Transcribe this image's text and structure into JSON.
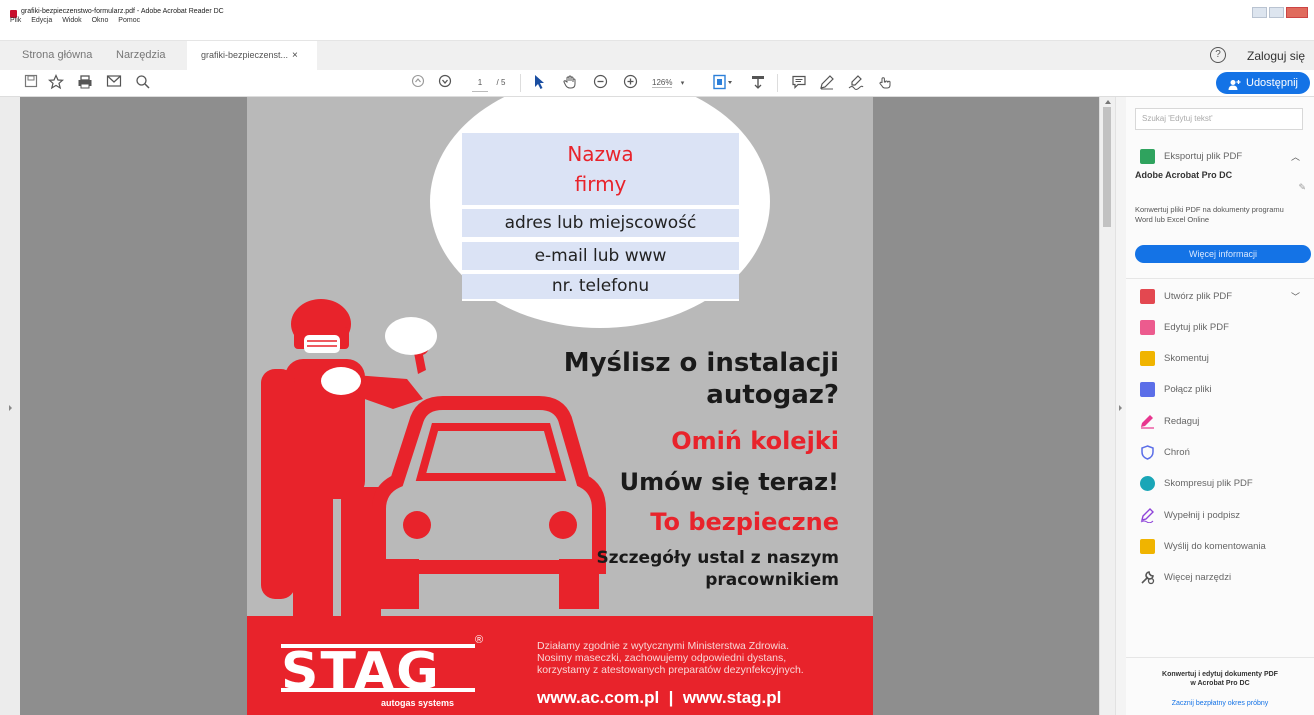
{
  "window": {
    "title": "grafiki-bezpieczenstwo-formularz.pdf - Adobe Acrobat Reader DC",
    "menu": [
      "Plik",
      "Edycja",
      "Widok",
      "Okno",
      "Pomoc"
    ]
  },
  "tabs": {
    "home": "Strona główna",
    "tools": "Narzędzia",
    "document": "grafiki-bezpieczenst...",
    "close": "×"
  },
  "header": {
    "help": "?",
    "login": "Zaloguj się"
  },
  "toolbar": {
    "page_current": "1",
    "page_total": "/ 5",
    "zoom": "126%",
    "share": "Udostępnij"
  },
  "document": {
    "company_name_line1": "Nazwa",
    "company_name_line2": "firmy",
    "address": "adres lub miejscowość",
    "email": "e-mail lub www",
    "phone": "nr. telefonu",
    "question_line1": "Myślisz o instalacji",
    "question_line2": "autogaz?",
    "skip_queue": "Omiń kolejki",
    "book_now": "Umów się teraz!",
    "safe": "To bezpieczne",
    "details_line1": "Szczegóły ustal z naszym",
    "details_line2": "pracownikiem",
    "logo_word": "STAG",
    "logo_sub": "autogas systems",
    "logo_reg": "®",
    "footer_line1": "Działamy zgodnie z wytycznymi Ministerstwa Zdrowia.",
    "footer_line2": "Nosimy maseczki, zachowujemy odpowiedni dystans,",
    "footer_line3": "korzystamy z atestowanych preparatów dezynfekcyjnych.",
    "urls": "www.ac.com.pl  |  www.stag.pl"
  },
  "right_panel": {
    "search_placeholder": "Szukaj 'Edytuj tekst'",
    "export": "Eksportuj plik PDF",
    "promo_title": "Adobe Acrobat Pro DC",
    "promo_text": "Konwertuj pliki PDF na dokumenty programu Word lub Excel Online",
    "promo_button": "Więcej informacji",
    "tools": [
      {
        "label": "Utwórz plik PDF",
        "color": "#e34850"
      },
      {
        "label": "Edytuj plik PDF",
        "color": "#ec5b8e"
      },
      {
        "label": "Skomentuj",
        "color": "#f0b400"
      },
      {
        "label": "Połącz pliki",
        "color": "#5b6ee8"
      },
      {
        "label": "Redaguj",
        "color": "#e8368f"
      },
      {
        "label": "Chroń",
        "color": "#5b6ee8"
      },
      {
        "label": "Skompresuj plik PDF",
        "color": "#1aa6b7"
      },
      {
        "label": "Wypełnij i podpisz",
        "color": "#8e44d9"
      },
      {
        "label": "Wyślij do komentowania",
        "color": "#f0b400"
      },
      {
        "label": "Więcej narzędzi",
        "color": "#555555"
      }
    ],
    "bottom_note_line1": "Konwertuj i edytuj dokumenty PDF",
    "bottom_note_line2": "w Acrobat Pro DC",
    "bottom_link": "Zacznij bezpłatny okres próbny"
  },
  "colors": {
    "accent": "#1473e6",
    "brand_red": "#e8232b"
  }
}
